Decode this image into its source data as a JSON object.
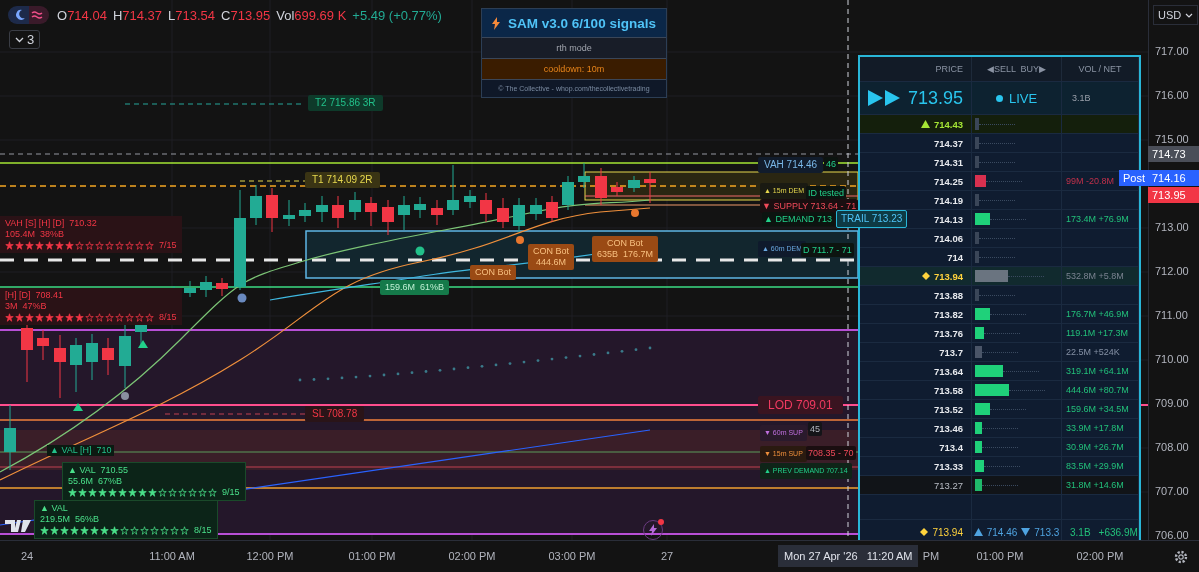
{
  "toolbar": {
    "collapse_count": "3"
  },
  "legend": [
    {
      "label": "O",
      "value": "714.04"
    },
    {
      "label": "H",
      "value": "714.37"
    },
    {
      "label": "L",
      "value": "713.54"
    },
    {
      "label": "C",
      "value": "713.95"
    },
    {
      "label": "Vol",
      "value": "699.69 K"
    }
  ],
  "change": "+5.49 (+0.77%)",
  "currency": "USD",
  "sam_panel": {
    "title": "SAM v3.0  6/100 signals",
    "mode": "rth mode",
    "cooldown": "cooldown: 10m",
    "footer": "© The Collective - whop.com/thecollectivetrading"
  },
  "chart_labels": [
    {
      "kind": "target",
      "text": "T2  715.86  3R"
    },
    {
      "kind": "target_yellow",
      "text": "T1  714.09  2R"
    },
    {
      "kind": "stop",
      "text": "SL  708.78"
    },
    {
      "kind": "vah",
      "text": "VAH  714.46"
    },
    {
      "kind": "text_green",
      "text": "46"
    },
    {
      "kind": "zone_yellow",
      "text": "▲ 15m DEM"
    },
    {
      "kind": "text_green",
      "text": "ID tested"
    },
    {
      "kind": "text_red",
      "text": "▼ SUPPLY  713.64 - 71"
    },
    {
      "kind": "text_green",
      "text": "▲ DEMAND  713"
    },
    {
      "kind": "trail",
      "text": "TRAIL  713.23"
    },
    {
      "kind": "zone_blue",
      "text": "▲ 60m DEM"
    },
    {
      "kind": "text_green",
      "text": "D  711.7 - 71"
    },
    {
      "kind": "lod",
      "text": "LOD  709.01"
    },
    {
      "kind": "zone_purple",
      "text": "▼ 60m SUP"
    },
    {
      "kind": "text_grey",
      "text": "45"
    },
    {
      "kind": "zone_orange",
      "text": "▼ 15m SUP"
    },
    {
      "kind": "text_red",
      "text": "708.35 - 70"
    },
    {
      "kind": "zone_green",
      "text": "▲ PREV DEMAND  707.14"
    }
  ],
  "info_boxes": [
    {
      "kind": "bear",
      "lines": [
        "VAH [S] [H] [D]  710.32",
        "105.4M  38%B"
      ],
      "stars": 7,
      "score": "7/15"
    },
    {
      "kind": "bear",
      "lines": [
        "[H] [D]  708.41",
        "3M  47%B"
      ],
      "stars": 8,
      "score": "8/15"
    },
    {
      "kind": "bull_text",
      "lines": [
        "▲ VAL [H]  710"
      ]
    },
    {
      "kind": "bull",
      "lines": [
        "▲ VAL  710.55",
        "55.6M  67%B"
      ],
      "stars": 9,
      "score": "9/15"
    },
    {
      "kind": "bull",
      "lines": [
        "▲ VAL",
        "219.5M  56%B"
      ],
      "stars": 8,
      "score": "8/15"
    },
    {
      "kind": "demand",
      "lines": [
        "159.6M  61%B"
      ]
    },
    {
      "kind": "con",
      "lines": [
        "CON Bot"
      ]
    },
    {
      "kind": "con",
      "lines": [
        "CON Bot",
        "444.6M"
      ]
    },
    {
      "kind": "con",
      "lines": [
        "CON Bot",
        "635B  176.7M"
      ]
    }
  ],
  "order_book": {
    "columns": [
      "PRICE",
      "◀SELL  BUY▶",
      "VOL / NET"
    ],
    "last_price": "713.95",
    "status": "LIVE",
    "total_volume": "3.1B",
    "rows": [
      {
        "price": "714.43",
        "kind": "high",
        "level": 0.05
      },
      {
        "price": "714.37",
        "kind": "plain",
        "level": 0.05
      },
      {
        "price": "714.31",
        "kind": "plain",
        "level": 0.05
      },
      {
        "price": "714.25",
        "kind": "sell",
        "level": 0.13,
        "vol": "99M -20.8M"
      },
      {
        "price": "714.19",
        "kind": "plain",
        "level": 0.05
      },
      {
        "price": "714.13",
        "kind": "buy",
        "level": 0.17,
        "vol": "173.4M +76.9M"
      },
      {
        "price": "714.06",
        "kind": "plain",
        "level": 0.05
      },
      {
        "price": "714",
        "kind": "plain",
        "level": 0.05
      },
      {
        "price": "713.94",
        "kind": "poc",
        "level": 0.38,
        "vol": "532.8M +5.8M"
      },
      {
        "price": "713.88",
        "kind": "plain",
        "level": 0.05
      },
      {
        "price": "713.82",
        "kind": "buy",
        "level": 0.17,
        "vol": "176.7M +46.9M"
      },
      {
        "price": "713.76",
        "kind": "buy",
        "level": 0.1,
        "vol": "119.1M +17.3M"
      },
      {
        "price": "713.7",
        "kind": "thin",
        "level": 0.08,
        "vol": "22.5M +524K"
      },
      {
        "price": "713.64",
        "kind": "buy",
        "level": 0.32,
        "vol": "319.1M +64.1M"
      },
      {
        "price": "713.58",
        "kind": "buy",
        "level": 0.4,
        "vol": "444.6M +80.7M"
      },
      {
        "price": "713.52",
        "kind": "buy",
        "level": 0.17,
        "vol": "159.6M +34.5M"
      },
      {
        "price": "713.46",
        "kind": "buy",
        "level": 0.08,
        "vol": "33.9M +17.8M"
      },
      {
        "price": "713.4",
        "kind": "buy",
        "level": 0.08,
        "vol": "30.9M +26.7M"
      },
      {
        "price": "713.33",
        "kind": "buy",
        "level": 0.1,
        "vol": "83.5M +29.9M"
      },
      {
        "price": "713.27",
        "kind": "edge",
        "level": 0.08,
        "vol": "31.8M +14.6M"
      }
    ],
    "footer": {
      "poc": "713.94",
      "high": "714.46",
      "low": "713.3",
      "volume": "3.1B",
      "net": "+636.9M"
    }
  },
  "price_axis": {
    "ticks": [
      "717.00",
      "716.00",
      "715.00",
      "713.00",
      "712.00",
      "711.00",
      "710.00",
      "709.00",
      "708.00",
      "707.00",
      "706.00"
    ],
    "tags": [
      {
        "kind": "crosshair",
        "text": "714.73"
      },
      {
        "kind": "session",
        "text": "Post"
      },
      {
        "kind": "price",
        "text": "714.16"
      },
      {
        "kind": "last",
        "text": "713.95"
      }
    ]
  },
  "time_axis": {
    "ticks": [
      "24",
      "11:00 AM",
      "12:00 PM",
      "01:00 PM",
      "02:00 PM",
      "03:00 PM",
      "27",
      "PM",
      "01:00 PM",
      "02:00 PM"
    ],
    "crosshair_label": "Mon 27 Apr '26   11:20 AM"
  }
}
